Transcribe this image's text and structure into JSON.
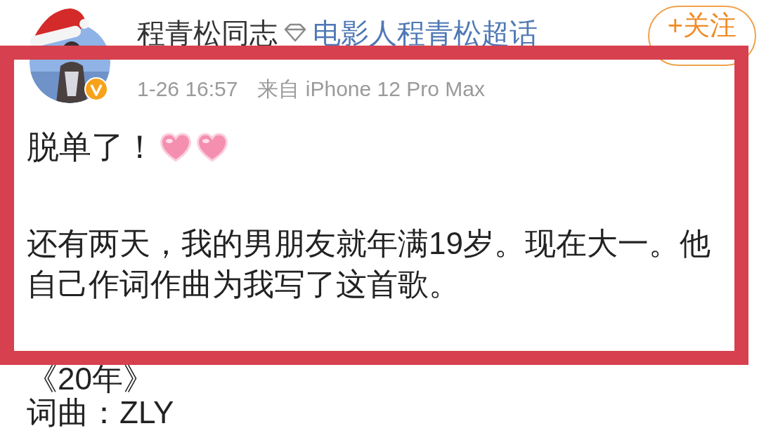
{
  "author": {
    "name": "程青松同志",
    "topic": "电影人程青松超话",
    "verified": true
  },
  "follow_button": {
    "label": "+关注"
  },
  "meta": {
    "time": "1-26 16:57",
    "source": "来自 iPhone 12 Pro Max"
  },
  "post": {
    "paragraphs": [
      {
        "kind": "hearts",
        "text": "脱单了！"
      },
      {
        "kind": "plain",
        "text": "还有两天，我的男朋友就年满19岁。现在大一。他自己作词作曲为我写了这首歌。"
      },
      {
        "kind": "plain",
        "text": "《20年》"
      },
      {
        "kind": "plain",
        "text": "词曲：ZLY"
      }
    ]
  }
}
